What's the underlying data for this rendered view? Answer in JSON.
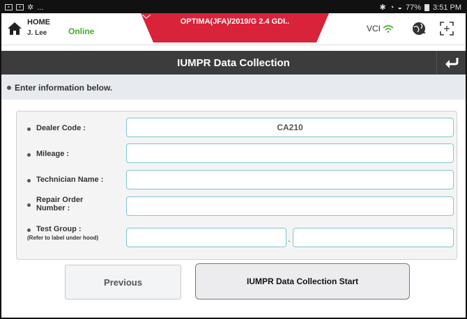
{
  "statusbar": {
    "dots": "...",
    "battery": "77%",
    "time": "3:51 PM"
  },
  "header": {
    "home_label": "HOME",
    "user": "J. Lee",
    "status": "Online",
    "status_color": "#3fae2a",
    "vehicle": "OPTIMA(JFA)/2019/G 2.4 GDI..",
    "vehicle_color": "#d8233a",
    "vci_label": "VCI",
    "icons": [
      "home-icon",
      "wifi-icon",
      "globe-icon",
      "screen-capture-icon"
    ]
  },
  "titlebar": {
    "title": "IUMPR Data Collection",
    "back_icon": "return-arrow-icon"
  },
  "instruction": "Enter information below.",
  "form": {
    "dealer_code": {
      "label": "Dealer Code :",
      "value": "CA210"
    },
    "mileage": {
      "label": "Mileage :",
      "value": ""
    },
    "technician_name": {
      "label": "Technician Name :",
      "value": ""
    },
    "repair_order": {
      "label": "Repair Order Number :",
      "value": ""
    },
    "test_group": {
      "label": "Test Group :",
      "sub": "(Refer to label under hood)",
      "separator": ".",
      "value1": "",
      "value2": ""
    }
  },
  "buttons": {
    "previous": "Previous",
    "start": "IUMPR Data Collection Start"
  }
}
